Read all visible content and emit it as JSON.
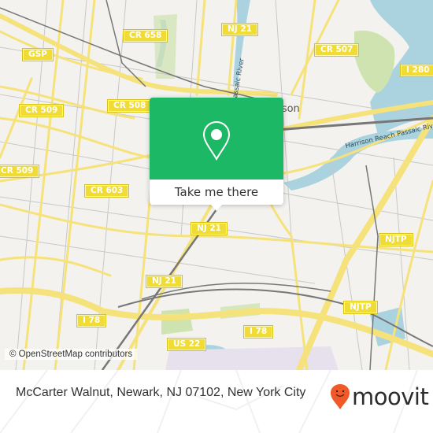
{
  "map": {
    "road_shields": [
      {
        "label": "CR 658"
      },
      {
        "label": "NJ 21"
      },
      {
        "label": "CR 507"
      },
      {
        "label": "GSP"
      },
      {
        "label": "I 280"
      },
      {
        "label": "CR 509"
      },
      {
        "label": "CR 508"
      },
      {
        "label": "CR 509"
      },
      {
        "label": "CR 603"
      },
      {
        "label": "NJ 21"
      },
      {
        "label": "NJTP"
      },
      {
        "label": "NJ 21"
      },
      {
        "label": "NJTP"
      },
      {
        "label": "I 78"
      },
      {
        "label": "I 78"
      },
      {
        "label": "US 22"
      }
    ],
    "place_labels": {
      "harrison": "Harrison",
      "passaic_river": "Passaic River",
      "harrison_reach": "Harrison Reach Passaic River"
    },
    "colors": {
      "background": "#f3f2ee",
      "road": "#f6e27a",
      "water": "#aad3df",
      "park": "#cfe3b0",
      "rail": "#777777",
      "brand_green": "#1db866"
    }
  },
  "popup": {
    "icon": "map-pin-icon",
    "button_label": "Take me there"
  },
  "attribution": "© OpenStreetMap contributors",
  "footer": {
    "address": "McCarter Walnut, Newark, NJ 07102, New York City",
    "brand": "moovit",
    "brand_color": "#f05a28"
  }
}
